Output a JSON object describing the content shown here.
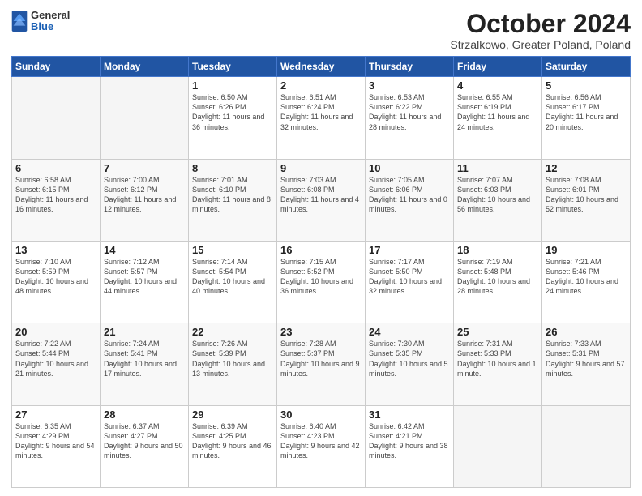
{
  "logo": {
    "general": "General",
    "blue": "Blue"
  },
  "title": "October 2024",
  "subtitle": "Strzalkowo, Greater Poland, Poland",
  "weekdays": [
    "Sunday",
    "Monday",
    "Tuesday",
    "Wednesday",
    "Thursday",
    "Friday",
    "Saturday"
  ],
  "weeks": [
    [
      {
        "day": "",
        "sunrise": "",
        "sunset": "",
        "daylight": ""
      },
      {
        "day": "",
        "sunrise": "",
        "sunset": "",
        "daylight": ""
      },
      {
        "day": "1",
        "sunrise": "Sunrise: 6:50 AM",
        "sunset": "Sunset: 6:26 PM",
        "daylight": "Daylight: 11 hours and 36 minutes."
      },
      {
        "day": "2",
        "sunrise": "Sunrise: 6:51 AM",
        "sunset": "Sunset: 6:24 PM",
        "daylight": "Daylight: 11 hours and 32 minutes."
      },
      {
        "day": "3",
        "sunrise": "Sunrise: 6:53 AM",
        "sunset": "Sunset: 6:22 PM",
        "daylight": "Daylight: 11 hours and 28 minutes."
      },
      {
        "day": "4",
        "sunrise": "Sunrise: 6:55 AM",
        "sunset": "Sunset: 6:19 PM",
        "daylight": "Daylight: 11 hours and 24 minutes."
      },
      {
        "day": "5",
        "sunrise": "Sunrise: 6:56 AM",
        "sunset": "Sunset: 6:17 PM",
        "daylight": "Daylight: 11 hours and 20 minutes."
      }
    ],
    [
      {
        "day": "6",
        "sunrise": "Sunrise: 6:58 AM",
        "sunset": "Sunset: 6:15 PM",
        "daylight": "Daylight: 11 hours and 16 minutes."
      },
      {
        "day": "7",
        "sunrise": "Sunrise: 7:00 AM",
        "sunset": "Sunset: 6:12 PM",
        "daylight": "Daylight: 11 hours and 12 minutes."
      },
      {
        "day": "8",
        "sunrise": "Sunrise: 7:01 AM",
        "sunset": "Sunset: 6:10 PM",
        "daylight": "Daylight: 11 hours and 8 minutes."
      },
      {
        "day": "9",
        "sunrise": "Sunrise: 7:03 AM",
        "sunset": "Sunset: 6:08 PM",
        "daylight": "Daylight: 11 hours and 4 minutes."
      },
      {
        "day": "10",
        "sunrise": "Sunrise: 7:05 AM",
        "sunset": "Sunset: 6:06 PM",
        "daylight": "Daylight: 11 hours and 0 minutes."
      },
      {
        "day": "11",
        "sunrise": "Sunrise: 7:07 AM",
        "sunset": "Sunset: 6:03 PM",
        "daylight": "Daylight: 10 hours and 56 minutes."
      },
      {
        "day": "12",
        "sunrise": "Sunrise: 7:08 AM",
        "sunset": "Sunset: 6:01 PM",
        "daylight": "Daylight: 10 hours and 52 minutes."
      }
    ],
    [
      {
        "day": "13",
        "sunrise": "Sunrise: 7:10 AM",
        "sunset": "Sunset: 5:59 PM",
        "daylight": "Daylight: 10 hours and 48 minutes."
      },
      {
        "day": "14",
        "sunrise": "Sunrise: 7:12 AM",
        "sunset": "Sunset: 5:57 PM",
        "daylight": "Daylight: 10 hours and 44 minutes."
      },
      {
        "day": "15",
        "sunrise": "Sunrise: 7:14 AM",
        "sunset": "Sunset: 5:54 PM",
        "daylight": "Daylight: 10 hours and 40 minutes."
      },
      {
        "day": "16",
        "sunrise": "Sunrise: 7:15 AM",
        "sunset": "Sunset: 5:52 PM",
        "daylight": "Daylight: 10 hours and 36 minutes."
      },
      {
        "day": "17",
        "sunrise": "Sunrise: 7:17 AM",
        "sunset": "Sunset: 5:50 PM",
        "daylight": "Daylight: 10 hours and 32 minutes."
      },
      {
        "day": "18",
        "sunrise": "Sunrise: 7:19 AM",
        "sunset": "Sunset: 5:48 PM",
        "daylight": "Daylight: 10 hours and 28 minutes."
      },
      {
        "day": "19",
        "sunrise": "Sunrise: 7:21 AM",
        "sunset": "Sunset: 5:46 PM",
        "daylight": "Daylight: 10 hours and 24 minutes."
      }
    ],
    [
      {
        "day": "20",
        "sunrise": "Sunrise: 7:22 AM",
        "sunset": "Sunset: 5:44 PM",
        "daylight": "Daylight: 10 hours and 21 minutes."
      },
      {
        "day": "21",
        "sunrise": "Sunrise: 7:24 AM",
        "sunset": "Sunset: 5:41 PM",
        "daylight": "Daylight: 10 hours and 17 minutes."
      },
      {
        "day": "22",
        "sunrise": "Sunrise: 7:26 AM",
        "sunset": "Sunset: 5:39 PM",
        "daylight": "Daylight: 10 hours and 13 minutes."
      },
      {
        "day": "23",
        "sunrise": "Sunrise: 7:28 AM",
        "sunset": "Sunset: 5:37 PM",
        "daylight": "Daylight: 10 hours and 9 minutes."
      },
      {
        "day": "24",
        "sunrise": "Sunrise: 7:30 AM",
        "sunset": "Sunset: 5:35 PM",
        "daylight": "Daylight: 10 hours and 5 minutes."
      },
      {
        "day": "25",
        "sunrise": "Sunrise: 7:31 AM",
        "sunset": "Sunset: 5:33 PM",
        "daylight": "Daylight: 10 hours and 1 minute."
      },
      {
        "day": "26",
        "sunrise": "Sunrise: 7:33 AM",
        "sunset": "Sunset: 5:31 PM",
        "daylight": "Daylight: 9 hours and 57 minutes."
      }
    ],
    [
      {
        "day": "27",
        "sunrise": "Sunrise: 6:35 AM",
        "sunset": "Sunset: 4:29 PM",
        "daylight": "Daylight: 9 hours and 54 minutes."
      },
      {
        "day": "28",
        "sunrise": "Sunrise: 6:37 AM",
        "sunset": "Sunset: 4:27 PM",
        "daylight": "Daylight: 9 hours and 50 minutes."
      },
      {
        "day": "29",
        "sunrise": "Sunrise: 6:39 AM",
        "sunset": "Sunset: 4:25 PM",
        "daylight": "Daylight: 9 hours and 46 minutes."
      },
      {
        "day": "30",
        "sunrise": "Sunrise: 6:40 AM",
        "sunset": "Sunset: 4:23 PM",
        "daylight": "Daylight: 9 hours and 42 minutes."
      },
      {
        "day": "31",
        "sunrise": "Sunrise: 6:42 AM",
        "sunset": "Sunset: 4:21 PM",
        "daylight": "Daylight: 9 hours and 38 minutes."
      },
      {
        "day": "",
        "sunrise": "",
        "sunset": "",
        "daylight": ""
      },
      {
        "day": "",
        "sunrise": "",
        "sunset": "",
        "daylight": ""
      }
    ]
  ]
}
